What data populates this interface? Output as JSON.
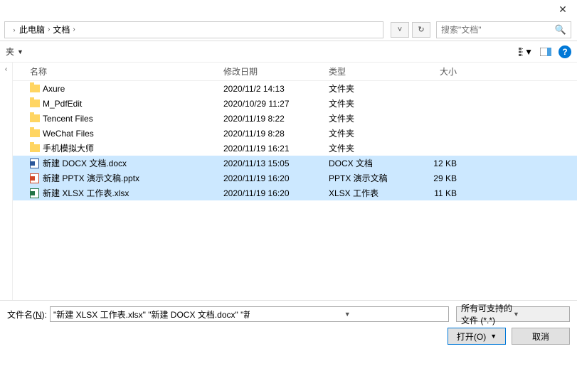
{
  "titlebar": {
    "close": "✕"
  },
  "breadcrumb": {
    "parts": [
      "此电脑",
      "文档"
    ]
  },
  "nav": {
    "refresh": "↻",
    "down": "˅"
  },
  "search": {
    "placeholder": "搜索\"文档\""
  },
  "toolbar": {
    "organize": "夹"
  },
  "columns": {
    "name": "名称",
    "date": "修改日期",
    "type": "类型",
    "size": "大小"
  },
  "rows": [
    {
      "icon": "folder",
      "name": "Axure",
      "date": "2020/11/2 14:13",
      "type": "文件夹",
      "size": "",
      "sel": false
    },
    {
      "icon": "folder",
      "name": "M_PdfEdit",
      "date": "2020/10/29 11:27",
      "type": "文件夹",
      "size": "",
      "sel": false
    },
    {
      "icon": "folder",
      "name": "Tencent Files",
      "date": "2020/11/19 8:22",
      "type": "文件夹",
      "size": "",
      "sel": false
    },
    {
      "icon": "folder",
      "name": "WeChat Files",
      "date": "2020/11/19 8:28",
      "type": "文件夹",
      "size": "",
      "sel": false
    },
    {
      "icon": "folder",
      "name": "手机模拟大师",
      "date": "2020/11/19 16:21",
      "type": "文件夹",
      "size": "",
      "sel": false
    },
    {
      "icon": "docx",
      "name": "新建 DOCX 文档.docx",
      "date": "2020/11/13 15:05",
      "type": "DOCX 文档",
      "size": "12 KB",
      "sel": true
    },
    {
      "icon": "pptx",
      "name": "新建 PPTX 演示文稿.pptx",
      "date": "2020/11/19 16:20",
      "type": "PPTX 演示文稿",
      "size": "29 KB",
      "sel": true
    },
    {
      "icon": "xlsx",
      "name": "新建 XLSX 工作表.xlsx",
      "date": "2020/11/19 16:20",
      "type": "XLSX 工作表",
      "size": "11 KB",
      "sel": true
    }
  ],
  "filename": {
    "label_pre": "文件名(",
    "label_u": "N",
    "label_post": "):",
    "value": "\"新建 XLSX 工作表.xlsx\" \"新建 DOCX 文档.docx\" \"新建 PPTX 演示文稿.pptx\""
  },
  "filter": {
    "label": "所有可支持的文件 (*.*)"
  },
  "buttons": {
    "open": "打开(O)",
    "cancel": "取消"
  }
}
